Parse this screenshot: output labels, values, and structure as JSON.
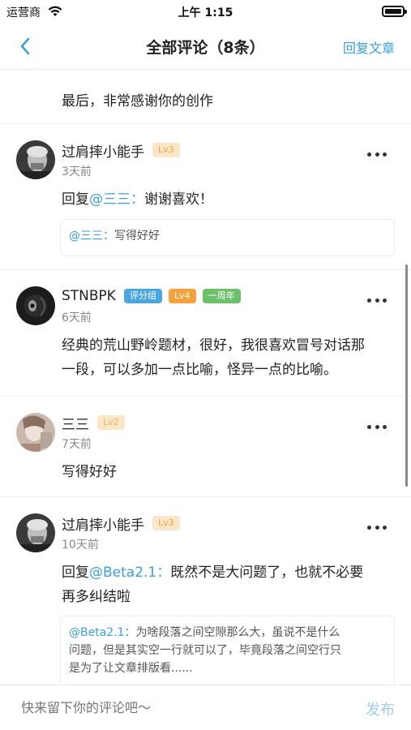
{
  "status_bar": {
    "carrier": "运营商",
    "time": "上午 1:15"
  },
  "nav": {
    "title": "全部评论（8条）",
    "reply_article": "回复文章"
  },
  "top_comment_tail": "最后，非常感谢你的创作",
  "comments": [
    {
      "username": "过肩摔小能手",
      "level": "Lv3",
      "time": "3天前",
      "reply_prefix": "回复",
      "reply_to": "@三三：",
      "text": "谢谢喜欢！",
      "quote_user": "@三三：",
      "quote_text": "写得好好"
    },
    {
      "username": "STNBPK",
      "role_badge": "评分组",
      "level": "Lv4",
      "anniv_badge": "一周年",
      "time": "6天前",
      "text_line1": "经典的荒山野岭题材，很好，我很喜欢冒号对话那",
      "text_line2": "一段，可以多加一点比喻，怪异一点的比喻。"
    },
    {
      "username": "三三",
      "level": "Lv2",
      "time": "7天前",
      "text": "写得好好"
    },
    {
      "username": "过肩摔小能手",
      "level": "Lv3",
      "time": "10天前",
      "reply_prefix": "回复",
      "reply_to": "@Beta2.1：",
      "text_line1": "既然不是大问题了，也就不必要",
      "text_line2": "再多纠结啦",
      "quote_user": "@Beta2.1：",
      "quote_line1": "为啥段落之间空隙那么大，虽说不是什么",
      "quote_line2": "问题，但是其实空一行就可以了，毕竟段落之间空行只",
      "quote_line3": "是为了让文章排版看......"
    }
  ],
  "bottom": {
    "input_placeholder": "快来留下你的评论吧～",
    "publish_label": "发布"
  },
  "colors": {
    "accent": "#3a9fdc",
    "badge_lv3_bg": "#fbe6c8",
    "badge_lv4_bg": "#f5a23c",
    "badge_role_bg": "#4ba6e0",
    "badge_anniv_bg": "#6cc06a"
  },
  "icons": {
    "back": "chevron-left-icon",
    "more": "more-dots-icon",
    "wifi": "wifi-icon",
    "battery": "battery-icon"
  }
}
